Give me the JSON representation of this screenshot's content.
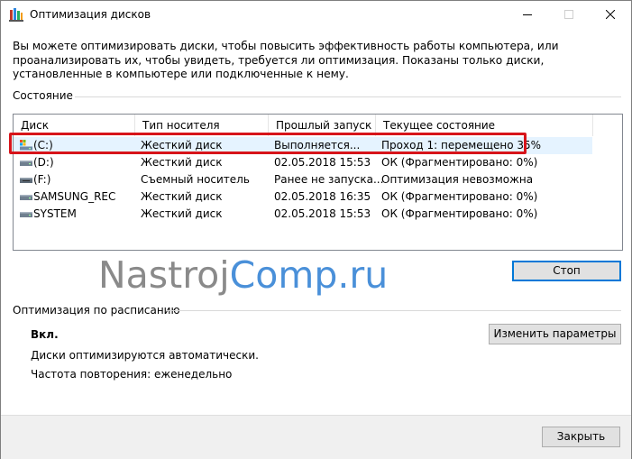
{
  "window": {
    "title": "Оптимизация дисков",
    "icon": "defrag-app-icon"
  },
  "intro": "Вы можете оптимизировать диски, чтобы повысить эффективность работы  компьютера, или проанализировать их, чтобы увидеть, требуется ли оптимизация. Показаны только диски, установленные в компьютере или подключенные к нему.",
  "status_section": {
    "label": "Состояние",
    "columns": [
      "Диск",
      "Тип носителя",
      "Прошлый запуск",
      "Текущее состояние"
    ],
    "rows": [
      {
        "disk": "(C:)",
        "type": "Жесткий диск",
        "last_run": "Выполняется...",
        "status": "Проход 1: перемещено 35%",
        "icon": "system-drive-icon",
        "selected": true
      },
      {
        "disk": "(D:)",
        "type": "Жесткий диск",
        "last_run": "02.05.2018 15:53",
        "status": "ОК (Фрагментировано: 0%)",
        "icon": "hard-drive-icon"
      },
      {
        "disk": "(F:)",
        "type": "Съемный носитель",
        "last_run": "Ранее не запуска...",
        "status": "Оптимизация невозможна",
        "icon": "removable-drive-icon"
      },
      {
        "disk": "SAMSUNG_REC",
        "type": "Жесткий диск",
        "last_run": "02.05.2018 16:35",
        "status": "ОК (Фрагментировано: 0%)",
        "icon": "hard-drive-icon"
      },
      {
        "disk": "SYSTEM",
        "type": "Жесткий диск",
        "last_run": "02.05.2018 15:53",
        "status": "ОК (Фрагментировано: 0%)",
        "icon": "hard-drive-icon"
      }
    ],
    "stop_button": "Стоп"
  },
  "watermark": {
    "part1": "Nastroj",
    "part2": "Comp.ru"
  },
  "schedule_section": {
    "label": "Оптимизация по расписанию",
    "state": "Вкл.",
    "line1": "Диски оптимизируются автоматически.",
    "line2": "Частота повторения: еженедельно",
    "change_button": "Изменить параметры"
  },
  "footer": {
    "close_button": "Закрыть"
  },
  "colors": {
    "highlight": "#d7141a",
    "selection": "#e5f3ff",
    "accent": "#0078d7"
  }
}
